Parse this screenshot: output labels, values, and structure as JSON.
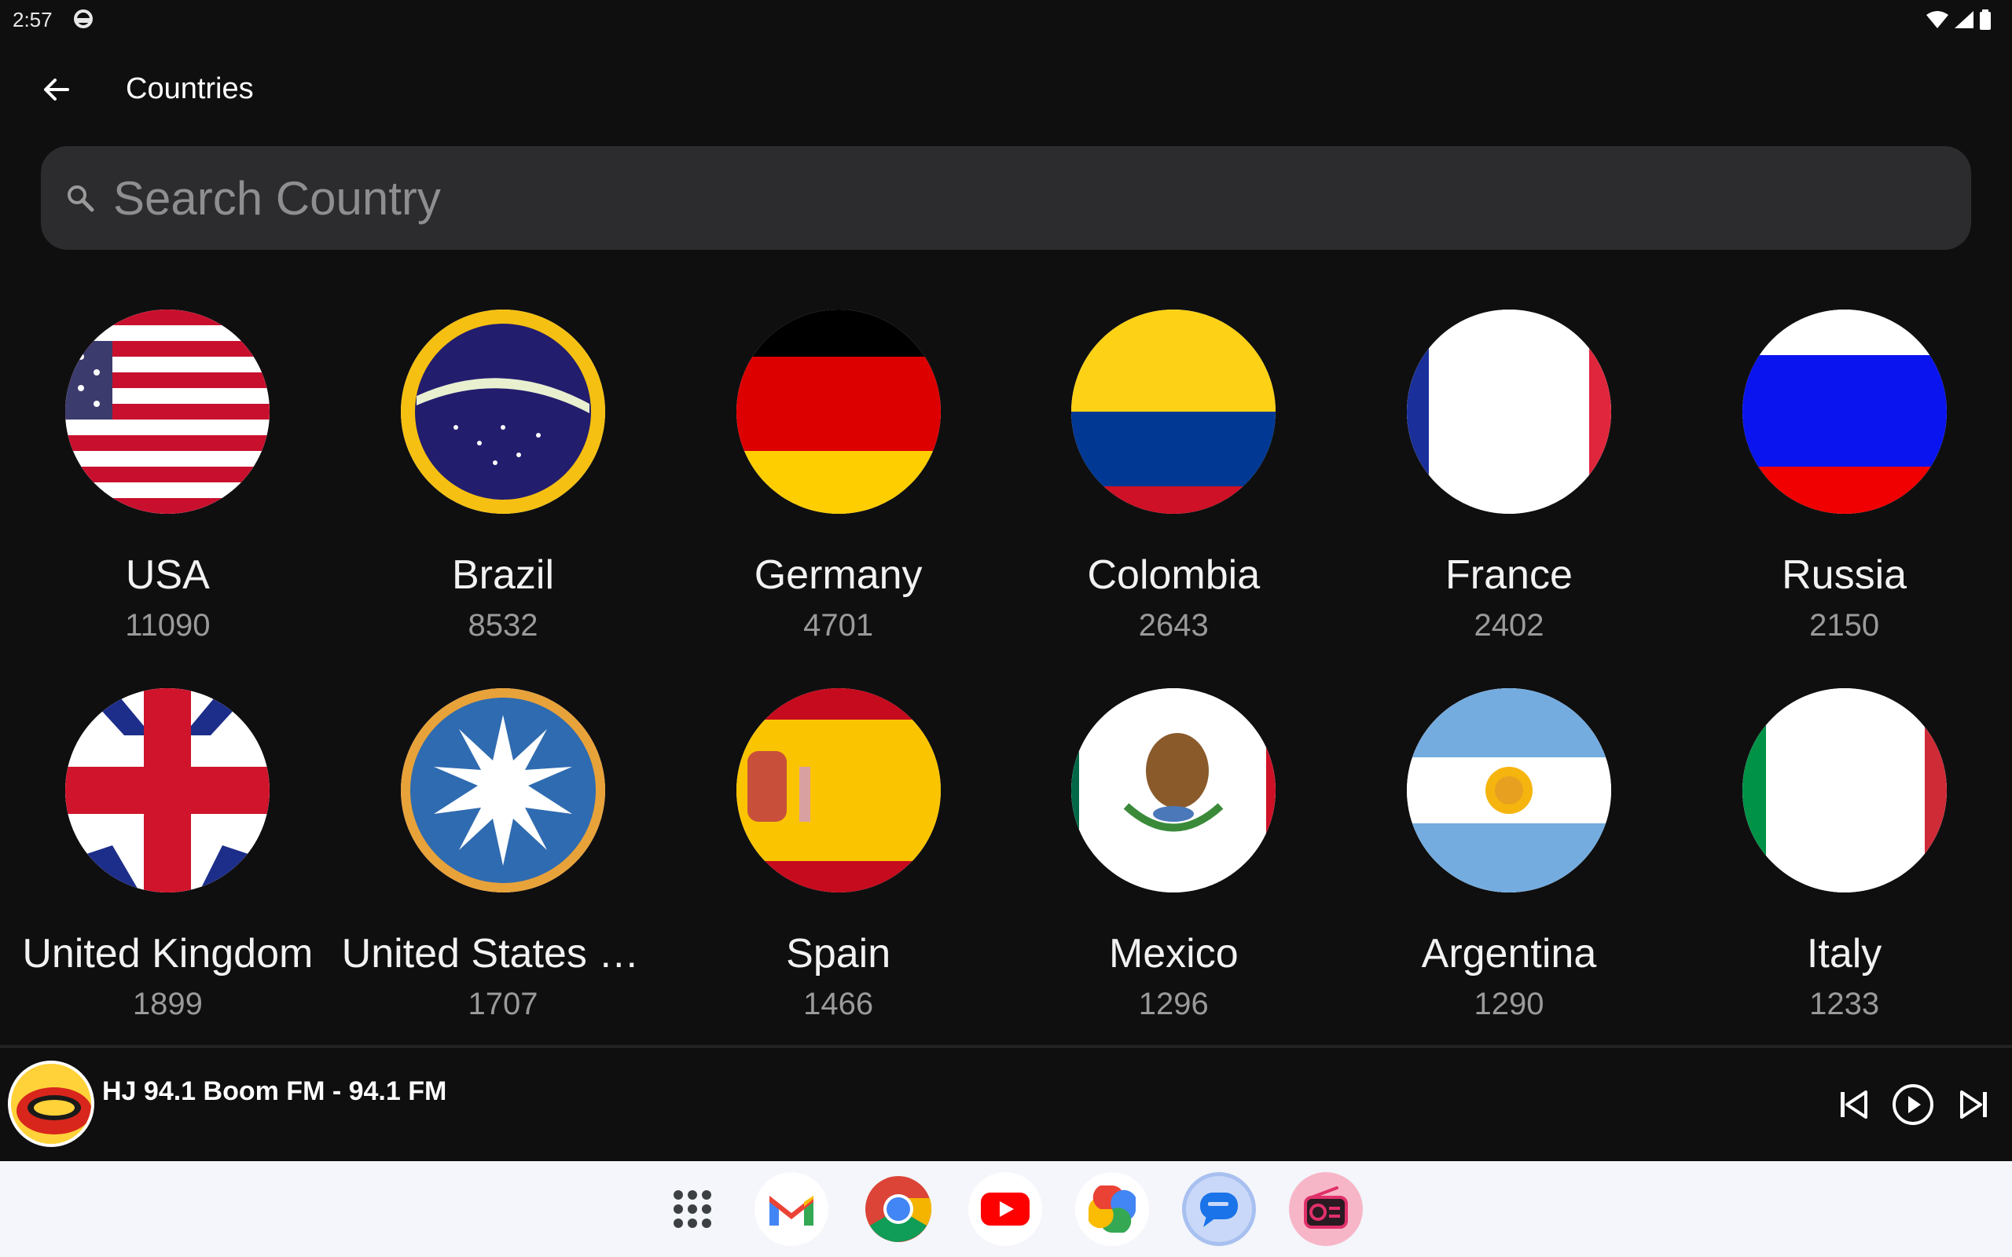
{
  "status": {
    "time": "2:57"
  },
  "toolbar": {
    "title": "Countries"
  },
  "search": {
    "placeholder": "Search Country",
    "value": ""
  },
  "countries": [
    {
      "name": "USA",
      "count": "11090"
    },
    {
      "name": "Brazil",
      "count": "8532"
    },
    {
      "name": "Germany",
      "count": "4701"
    },
    {
      "name": "Colombia",
      "count": "2643"
    },
    {
      "name": "France",
      "count": "2402"
    },
    {
      "name": "Russia",
      "count": "2150"
    },
    {
      "name": "United Kingdom",
      "count": "1899"
    },
    {
      "name": "United States Mi...",
      "count": "1707"
    },
    {
      "name": "Spain",
      "count": "1466"
    },
    {
      "name": "Mexico",
      "count": "1296"
    },
    {
      "name": "Argentina",
      "count": "1290"
    },
    {
      "name": "Italy",
      "count": "1233"
    }
  ],
  "player": {
    "station": "HJ 94.1 Boom FM - 94.1 FM"
  },
  "dock": {
    "apps": [
      "app-drawer-icon",
      "gmail-icon",
      "chrome-icon",
      "youtube-icon",
      "photos-icon",
      "messages-icon",
      "radio-app-icon"
    ]
  },
  "colors": {
    "background": "#0f0f10",
    "search_bg": "#2c2c2e",
    "muted_text": "#9a9a9a"
  }
}
